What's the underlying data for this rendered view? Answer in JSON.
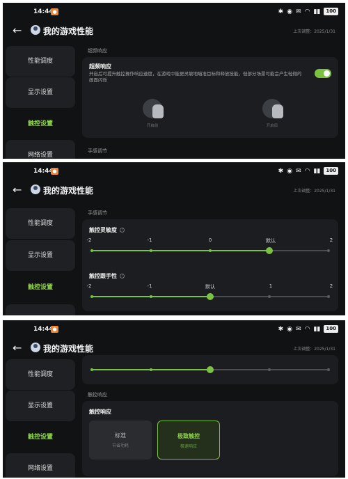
{
  "status": {
    "time": "14:44",
    "battery": "100"
  },
  "header": {
    "title": "我的游戏性能",
    "updated": "上次调整：2025/1/31"
  },
  "sidebar": {
    "items": [
      {
        "label": "性能调度"
      },
      {
        "label": "显示设置"
      },
      {
        "label": "触控设置",
        "active": true
      },
      {
        "label": "网络设置"
      }
    ]
  },
  "ultra_response": {
    "section": "超频响应",
    "title": "超频响应",
    "desc": "开启后可提升触控操作响应速度，在游戏中能更灵敏地瞄准目标和释放技能，但部分场景可能会产生轻微的画面闪烁",
    "enabled": true,
    "off_caption": "开启前",
    "on_caption": "开启后"
  },
  "feel": {
    "section": "手感调节",
    "sensitivity": {
      "title": "触控灵敏度",
      "ticks": [
        "-2",
        "-1",
        "0",
        "默认",
        "2"
      ],
      "selected_index": 3
    },
    "follow": {
      "title": "触控跟手性",
      "ticks": [
        "-2",
        "-1",
        "默认",
        "1",
        "2"
      ],
      "selected_index": 2
    }
  },
  "touch_response": {
    "section": "触控响应",
    "title": "触控响应",
    "modes": [
      {
        "name": "标准",
        "sub": "节省功耗"
      },
      {
        "name": "极致触控",
        "sub": "极速响应",
        "selected": true
      }
    ]
  }
}
